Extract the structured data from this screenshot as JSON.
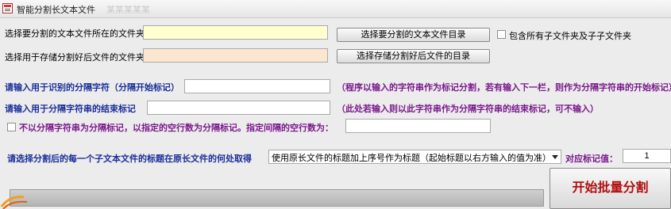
{
  "window": {
    "title": "智能分割长文本文件",
    "ghost_title": "某某某某某"
  },
  "source_folder": {
    "label": "选择要分割的文本文件所在的文件夹",
    "value": "",
    "input_bg": "#ffffd0",
    "button_label": "选择要分割的文本文件目录"
  },
  "include_subfolders": {
    "label": "包含所有子文件夹及子子文件夹",
    "checked": false
  },
  "output_folder": {
    "label": "选择用于存储分割好后文件的文件夹",
    "value": "",
    "input_bg": "#fde6d0",
    "button_label": "选择存储分割好后文件的目录"
  },
  "start_marker": {
    "label": "请输入用于识别的分隔字符（分隔开始标记）",
    "value": "",
    "hint": "（程序以输入的字符串作为标记分割，若有输入下一栏，则作为分隔字符串的开始标记）"
  },
  "end_marker": {
    "label": "请输入用于分隔字符串的结束标记",
    "value": "",
    "hint": "（此处若输入则以此字符串作为分隔字符串的结束标记，可不输入）"
  },
  "blank_line_option": {
    "label": "不以分隔字符串为分隔标记，以指定的空行数为分隔标记。指定间隔的空行数为：",
    "checked": false,
    "value": ""
  },
  "title_source": {
    "label": "请选择分割后的每一个子文本文件的标题在原长文件的何处取得",
    "selected": "使用原长文件的标题加上序号作为标题（起始标题以右方输入的值为准）",
    "marker_label": "对应标记值：",
    "marker_value": "1"
  },
  "progress": {
    "value": 0
  },
  "start_button": {
    "label": "开始批量分割"
  },
  "colors": {
    "label_blue": "#1b2f9a",
    "hint_purple": "#7a1a8c",
    "start_text": "#b01010"
  }
}
